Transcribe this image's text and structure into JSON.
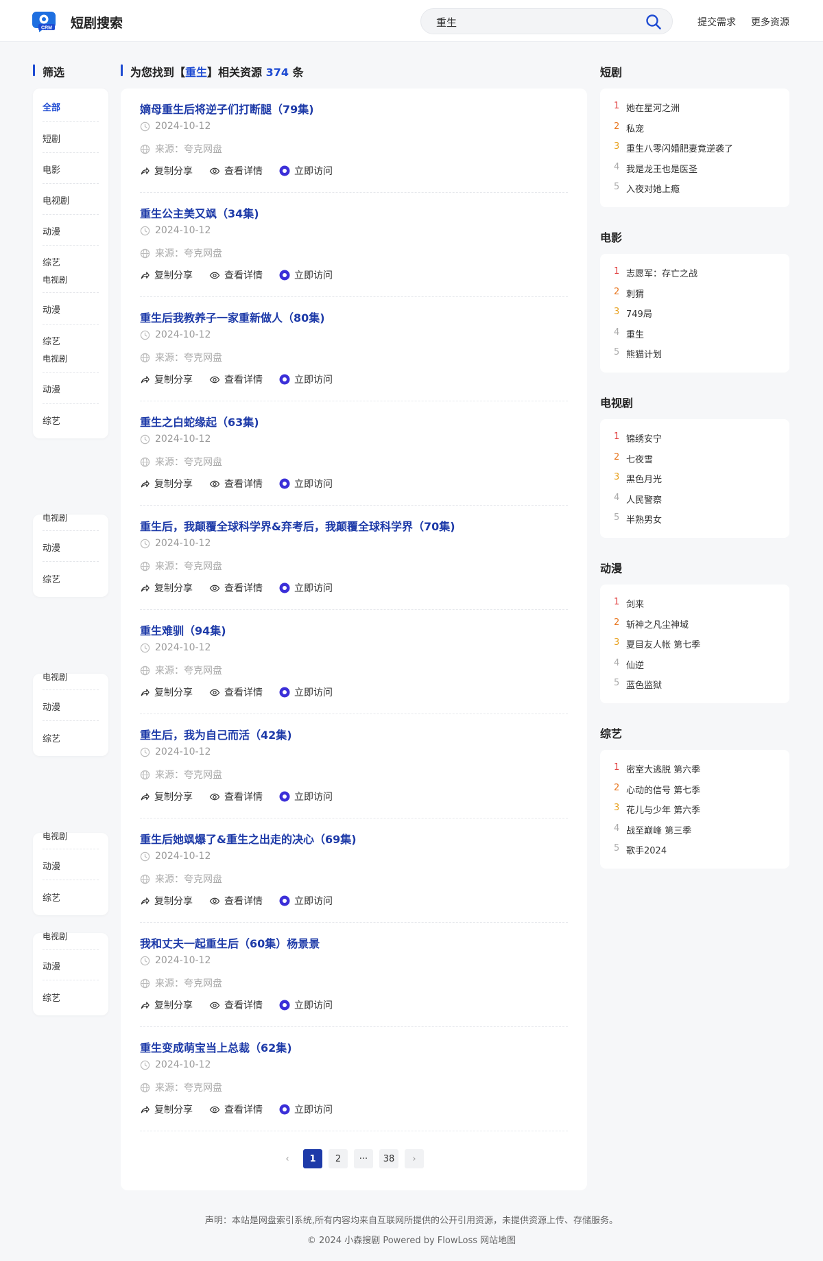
{
  "header": {
    "brand": "短剧搜索",
    "logo_text": "CRM",
    "search_value": "重生",
    "links": [
      "提交需求",
      "更多资源"
    ]
  },
  "filter": {
    "title": "筛选",
    "groups": [
      [
        "全部",
        "短剧",
        "电影",
        "电视剧",
        "动漫",
        "综艺"
      ],
      [
        "电视剧",
        "动漫",
        "综艺"
      ],
      [
        "电视剧",
        "动漫",
        "综艺"
      ],
      [
        "电视剧",
        "动漫",
        "综艺"
      ],
      [
        "电视剧",
        "动漫",
        "综艺"
      ],
      [
        "电视剧",
        "动漫",
        "综艺"
      ]
    ]
  },
  "results_header": {
    "prefix": "为您找到【",
    "keyword": "重生",
    "middle": "】相关资源 ",
    "count": "374",
    "suffix": " 条"
  },
  "results": [
    {
      "title": "嫡母重生后将逆子们打断腿（79集)",
      "date": "2024-10-12",
      "source": "来源：夸克网盘"
    },
    {
      "title": "重生公主美又飒（34集)",
      "date": "2024-10-12",
      "source": "来源：夸克网盘"
    },
    {
      "title": "重生后我教养子一家重新做人（80集)",
      "date": "2024-10-12",
      "source": "来源：夸克网盘"
    },
    {
      "title": "重生之白蛇缘起（63集)",
      "date": "2024-10-12",
      "source": "来源：夸克网盘"
    },
    {
      "title": "重生后，我颠覆全球科学界&弃考后，我颠覆全球科学界（70集)",
      "date": "2024-10-12",
      "source": "来源：夸克网盘"
    },
    {
      "title": "重生难驯（94集)",
      "date": "2024-10-12",
      "source": "来源：夸克网盘"
    },
    {
      "title": "重生后，我为自己而活（42集)",
      "date": "2024-10-12",
      "source": "来源：夸克网盘"
    },
    {
      "title": "重生后她飒爆了&重生之出走的决心（69集)",
      "date": "2024-10-12",
      "source": "来源：夸克网盘"
    },
    {
      "title": "我和丈夫一起重生后（60集）杨景景",
      "date": "2024-10-12",
      "source": "来源：夸克网盘"
    },
    {
      "title": "重生变成萌宝当上总裁（62集)",
      "date": "2024-10-12",
      "source": "来源：夸克网盘"
    }
  ],
  "actions": {
    "share": "复制分享",
    "detail": "查看详情",
    "visit": "立即访问"
  },
  "pagination": {
    "pages": [
      "1",
      "2",
      "···",
      "38"
    ],
    "current": "1",
    "prev": "‹",
    "next": "›"
  },
  "rankings": [
    {
      "title": "短剧",
      "items": [
        "她在星河之洲",
        "私宠",
        "重生八零闪婚肥妻竟逆袭了",
        "我是龙王也是医圣",
        "入夜对她上瘾"
      ]
    },
    {
      "title": "电影",
      "items": [
        "志愿军：存亡之战",
        "刺猬",
        "749局",
        "重生",
        "熊猫计划"
      ]
    },
    {
      "title": "电视剧",
      "items": [
        "锦绣安宁",
        "七夜雪",
        "黑色月光",
        "人民警察",
        "半熟男女"
      ]
    },
    {
      "title": "动漫",
      "items": [
        "剑来",
        "斩神之凡尘神域",
        "夏目友人帐 第七季",
        "仙逆",
        "蓝色监狱"
      ]
    },
    {
      "title": "综艺",
      "items": [
        "密室大逃脱 第六季",
        "心动的信号 第七季",
        "花儿与少年 第六季",
        "战至巅峰 第三季",
        "歌手2024"
      ]
    }
  ],
  "footer": {
    "disclaimer": "声明：本站是网盘索引系统,所有内容均来自互联网所提供的公开引用资源，未提供资源上传、存储服务。",
    "copyright": "© 2024 小森搜剧 Powered by FlowLoss 网站地图"
  },
  "colors": {
    "accent": "#1d3aa8",
    "primary": "#1e4bd2",
    "rank1": "#e03a3a",
    "rank2": "#e8761f",
    "rank3": "#e8a11f"
  }
}
